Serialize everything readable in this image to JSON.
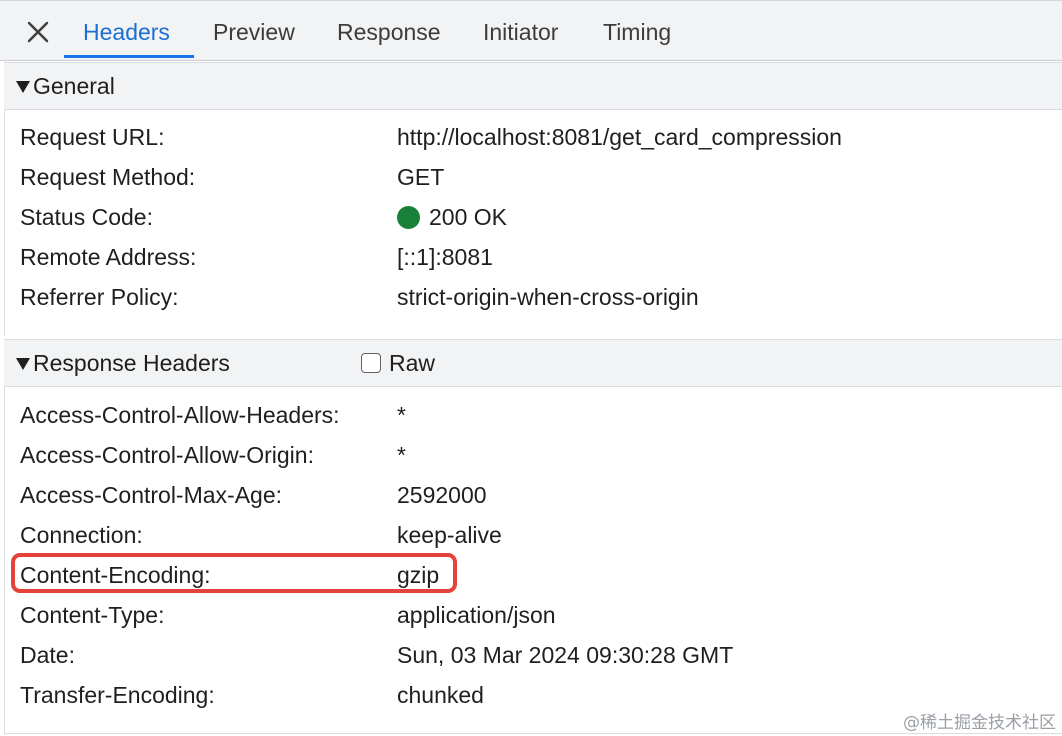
{
  "tabs": [
    {
      "label": "Headers",
      "active": true
    },
    {
      "label": "Preview",
      "active": false
    },
    {
      "label": "Response",
      "active": false
    },
    {
      "label": "Initiator",
      "active": false
    },
    {
      "label": "Timing",
      "active": false
    }
  ],
  "close_icon": "close-icon",
  "general": {
    "title": "General",
    "rows": [
      {
        "key": "Request URL:",
        "value": "http://localhost:8081/get_card_compression"
      },
      {
        "key": "Request Method:",
        "value": "GET"
      },
      {
        "key": "Status Code:",
        "value": "200 OK"
      },
      {
        "key": "Remote Address:",
        "value": "[::1]:8081"
      },
      {
        "key": "Referrer Policy:",
        "value": "strict-origin-when-cross-origin"
      }
    ],
    "status_color": "#188038"
  },
  "response_headers": {
    "title": "Response Headers",
    "raw_label": "Raw",
    "raw_checked": false,
    "rows": [
      {
        "key": "Access-Control-Allow-Headers:",
        "value": "*"
      },
      {
        "key": "Access-Control-Allow-Origin:",
        "value": "*"
      },
      {
        "key": "Access-Control-Max-Age:",
        "value": "2592000"
      },
      {
        "key": "Connection:",
        "value": "keep-alive"
      },
      {
        "key": "Content-Encoding:",
        "value": "gzip"
      },
      {
        "key": "Content-Type:",
        "value": "application/json"
      },
      {
        "key": "Date:",
        "value": "Sun, 03 Mar 2024 09:30:28 GMT"
      },
      {
        "key": "Transfer-Encoding:",
        "value": "chunked"
      }
    ],
    "highlight_color": "#e5423b"
  },
  "watermark": "@稀土掘金技术社区",
  "colors": {
    "accent": "#1a73e8",
    "header_bg": "#f1f3f4"
  }
}
